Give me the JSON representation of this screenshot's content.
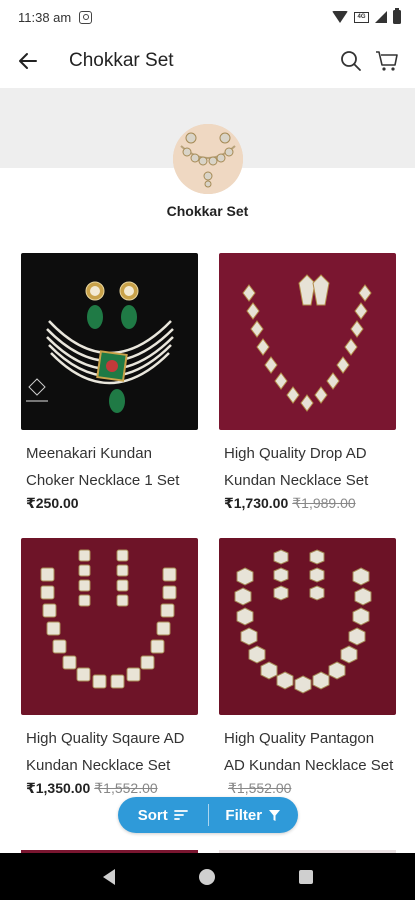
{
  "status_bar": {
    "time": "11:38 am",
    "icons": [
      "instagram-icon",
      "wifi-icon",
      "sim-icon",
      "signal-icon",
      "battery-icon"
    ]
  },
  "header": {
    "title": "Chokkar Set",
    "icons": [
      "back-arrow-icon",
      "search-icon",
      "cart-icon"
    ]
  },
  "category": {
    "label": "Chokkar Set"
  },
  "products": [
    {
      "name": "Meenakari Kundan Choker Necklace 1 Set",
      "price": "₹250.00",
      "mrp": ""
    },
    {
      "name": "High Quality Drop AD Kundan Necklace Set",
      "price": "₹1,730.00",
      "mrp": "₹1,989.00"
    },
    {
      "name": "High Quality Sqaure AD Kundan Necklace Set",
      "price": "₹1,350.00",
      "mrp": "₹1,552.00"
    },
    {
      "name": "High Quality Pantagon AD Kundan Necklace Set",
      "price": "",
      "mrp": "₹1,552.00"
    }
  ],
  "sort_filter": {
    "sort_label": "Sort",
    "filter_label": "Filter"
  },
  "colors": {
    "accent": "#2f9ad9",
    "banner": "#eeeeee",
    "velvet": "#7a1630",
    "black_bg": "#0d0d0d"
  }
}
